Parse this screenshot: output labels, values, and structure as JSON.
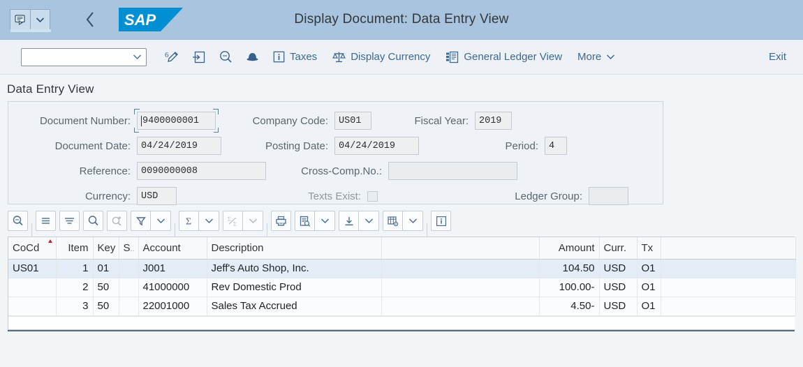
{
  "shell": {
    "title": "Display Document: Data Entry View",
    "logo_text": "SAP",
    "back_icon": "back-chevron-icon",
    "message_icon": "message-popup-icon",
    "message_dropdown_icon": "chevron-down-icon"
  },
  "action_bar": {
    "combo_value": "",
    "combo_placeholder": "",
    "combo_icon": "chevron-down-icon",
    "icons": [
      {
        "name": "edit-pen-icon",
        "title": "Change Document"
      },
      {
        "name": "display-document-icon",
        "title": "Display Document"
      },
      {
        "name": "search-magnifier-icon",
        "title": "Find"
      },
      {
        "name": "hat-icon",
        "title": "Document Overview"
      }
    ],
    "buttons": [
      {
        "label": "Taxes",
        "icon": "info-box-icon"
      },
      {
        "label": "Display Currency",
        "icon": "scales-icon"
      },
      {
        "label": "General Ledger View",
        "icon": "ledger-view-icon"
      },
      {
        "label": "More",
        "icon": "chevron-down-icon"
      }
    ],
    "exit_label": "Exit"
  },
  "page": {
    "section_title": "Data Entry View"
  },
  "form": {
    "document_number": {
      "label": "Document Number:",
      "value": "9400000001",
      "focused": true
    },
    "company_code": {
      "label": "Company Code:",
      "value": "US01"
    },
    "fiscal_year": {
      "label": "Fiscal Year:",
      "value": "2019"
    },
    "document_date": {
      "label": "Document Date:",
      "value": "04/24/2019"
    },
    "posting_date": {
      "label": "Posting Date:",
      "value": "04/24/2019"
    },
    "period": {
      "label": "Period:",
      "value": "4"
    },
    "reference": {
      "label": "Reference:",
      "value": "0090000008"
    },
    "cross_comp_no": {
      "label": "Cross-Comp.No.:",
      "value": ""
    },
    "currency": {
      "label": "Currency:",
      "value": "USD"
    },
    "texts_exist": {
      "label": "Texts Exist:",
      "checked": false
    },
    "ledger_group": {
      "label": "Ledger Group:",
      "value": ""
    }
  },
  "grid_toolbar": {
    "buttons": [
      {
        "name": "search-details-icon",
        "enabled": true
      },
      {
        "name": "sort-lines-icon",
        "enabled": true
      },
      {
        "name": "filter-lines-icon",
        "enabled": true
      },
      {
        "name": "find-icon",
        "enabled": true
      },
      {
        "name": "find-next-icon",
        "enabled": false
      },
      {
        "name": "filter-funnel-icon",
        "enabled": true
      },
      {
        "name": "filter-dropdown-icon",
        "enabled": true
      },
      {
        "name": "sum-sigma-icon",
        "enabled": true
      },
      {
        "name": "sum-dropdown-icon",
        "enabled": true
      },
      {
        "name": "subtotal-icon",
        "enabled": false
      },
      {
        "name": "subtotal-dropdown-icon",
        "enabled": false
      },
      {
        "name": "print-icon",
        "enabled": true
      },
      {
        "name": "layout-view-icon",
        "enabled": true
      },
      {
        "name": "layout-dropdown-icon",
        "enabled": true
      },
      {
        "name": "export-download-icon",
        "enabled": true
      },
      {
        "name": "export-dropdown-icon",
        "enabled": true
      },
      {
        "name": "grid-settings-icon",
        "enabled": true
      },
      {
        "name": "grid-settings-dropdown-icon",
        "enabled": true
      },
      {
        "name": "info-icon",
        "enabled": true
      }
    ]
  },
  "table": {
    "columns": [
      {
        "key": "cocd",
        "label": "CoCd",
        "align": "left",
        "sorted": true
      },
      {
        "key": "item",
        "label": "Item",
        "align": "right"
      },
      {
        "key": "key",
        "label": "Key",
        "align": "left"
      },
      {
        "key": "s",
        "label": "S",
        "align": "left",
        "truncated": true
      },
      {
        "key": "account",
        "label": "Account",
        "align": "left"
      },
      {
        "key": "description",
        "label": "Description",
        "align": "left"
      },
      {
        "key": "blank",
        "label": "",
        "align": "left"
      },
      {
        "key": "amount",
        "label": "Amount",
        "align": "right"
      },
      {
        "key": "curr",
        "label": "Curr.",
        "align": "left"
      },
      {
        "key": "tx",
        "label": "Tx",
        "align": "left"
      },
      {
        "key": "tail",
        "label": "",
        "align": "left"
      }
    ],
    "rows": [
      {
        "selected": true,
        "cocd": "US01",
        "item": "1",
        "key": "01",
        "s": "",
        "account": "J001",
        "description": "Jeff's Auto Shop, Inc.",
        "blank": "",
        "amount": "104.50",
        "curr": "USD",
        "tx": "O1",
        "tail": ""
      },
      {
        "selected": false,
        "cocd": "",
        "item": "2",
        "key": "50",
        "s": "",
        "account": "41000000",
        "description": "Rev Domestic Prod",
        "blank": "",
        "amount": "100.00-",
        "curr": "USD",
        "tx": "O1",
        "tail": ""
      },
      {
        "selected": false,
        "cocd": "",
        "item": "3",
        "key": "50",
        "s": "",
        "account": "22001000",
        "description": "Sales Tax Accrued",
        "blank": "",
        "amount": "4.50-",
        "curr": "USD",
        "tx": "O1",
        "tail": ""
      }
    ]
  },
  "colors": {
    "shell_header": "#a9c4de",
    "action_bar": "#eef2f6",
    "accent_link": "#3a6894",
    "sap_blue": "#008fd3",
    "selected_row": "#e3edf7",
    "sort_marker": "#b02838"
  }
}
